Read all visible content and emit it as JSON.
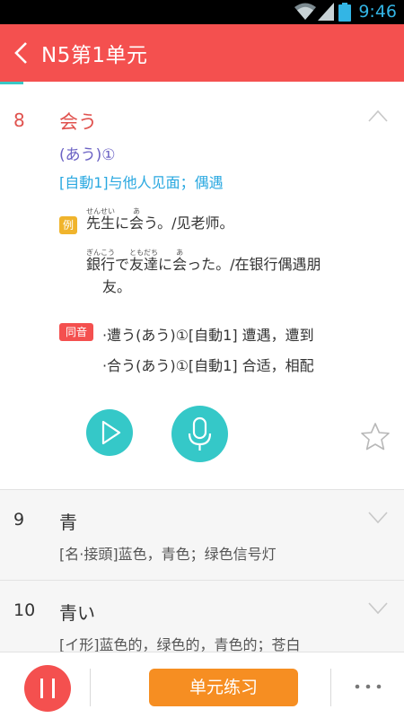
{
  "status_bar": {
    "time": "9:46"
  },
  "app_bar": {
    "title": "N5第1单元"
  },
  "current_word": {
    "number": "8",
    "headword": "会う",
    "reading": "(あう)①",
    "meaning": "[自動1]与他人见面；偶遇",
    "example_badge": "例",
    "examples": [
      {
        "segments": [
          {
            "text": "先生",
            "ruby": "せんせい"
          },
          {
            "text": "に"
          },
          {
            "text": "会",
            "ruby": "あ"
          },
          {
            "text": "う。/见老师。"
          }
        ]
      },
      {
        "segments": [
          {
            "text": "銀行",
            "ruby": "ぎんこう"
          },
          {
            "text": "で"
          },
          {
            "text": "友達",
            "ruby": "ともだち"
          },
          {
            "text": "に"
          },
          {
            "text": "会",
            "ruby": "あ"
          },
          {
            "text": "った。/在银行偶遇朋"
          }
        ],
        "continuation": "友。"
      }
    ],
    "homophone_badge": "同音",
    "homophones": [
      "·遭う(あう)①[自動1] 遭遇，遭到",
      "·合う(あう)①[自動1] 合适，相配"
    ]
  },
  "word_list": [
    {
      "number": "9",
      "headword": "青",
      "meaning": "[名·接頭]蓝色，青色；绿色信号灯"
    },
    {
      "number": "10",
      "headword": "青い",
      "meaning": "[イ形]蓝色的，绿色的，青色的；苍白"
    }
  ],
  "bottom_bar": {
    "practice_label": "单元练习"
  },
  "colors": {
    "accent": "#f4504f",
    "teal": "#35c8c8",
    "orange": "#f68e22"
  }
}
